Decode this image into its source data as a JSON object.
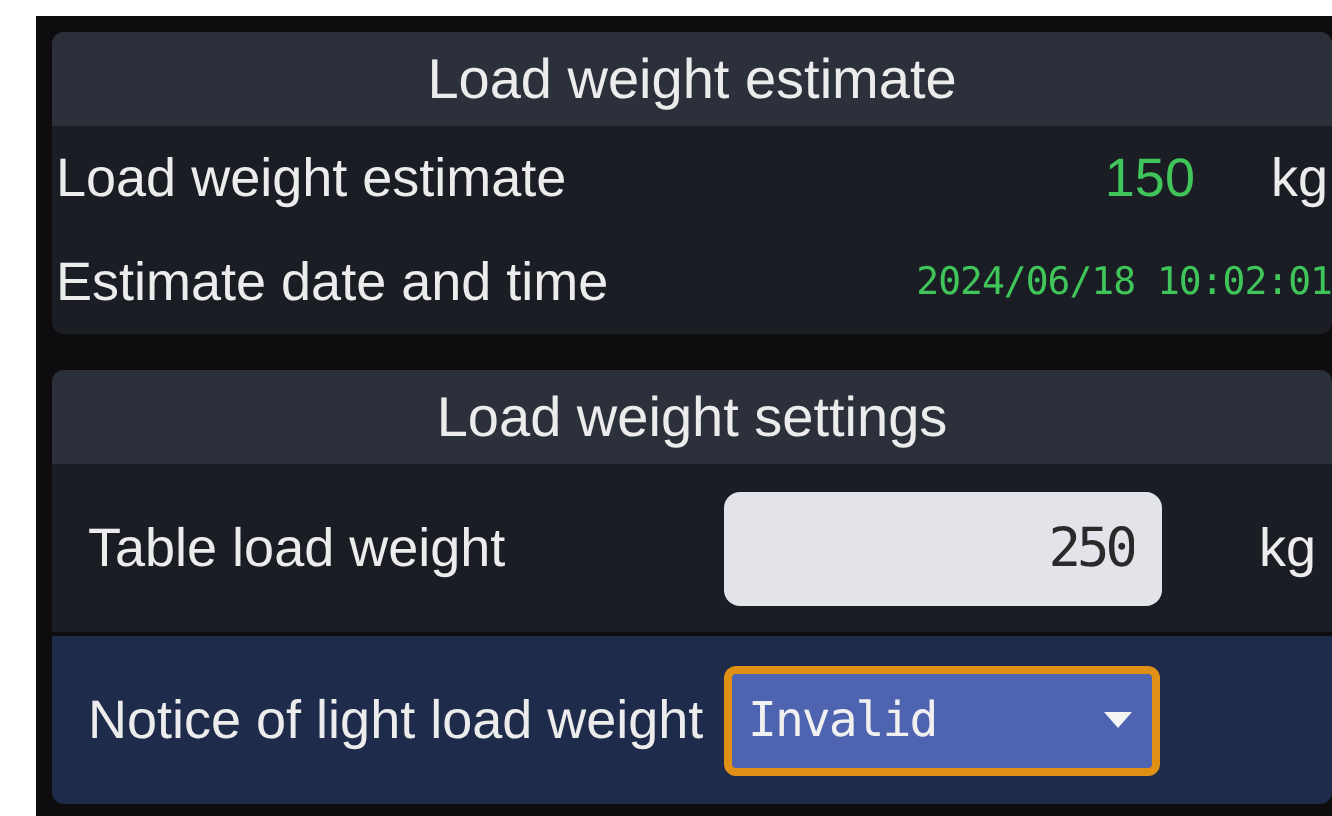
{
  "panels": [
    {
      "title": "Load weight estimate",
      "rows": [
        {
          "kind": "reading",
          "label": "Load weight estimate",
          "value": "150",
          "unit": "kg",
          "selected": false
        },
        {
          "kind": "datetime",
          "label": "Estimate date and time",
          "value": "2024/06/18 10:02:01",
          "selected": false
        }
      ]
    },
    {
      "title": "Load weight settings",
      "rows": [
        {
          "kind": "input",
          "label": "Table load weight",
          "value": "250",
          "unit": "kg",
          "selected": false
        },
        {
          "kind": "dropdown",
          "label": "Notice of light load weight",
          "value": "Invalid",
          "focused": true,
          "selected": true
        }
      ]
    }
  ]
}
